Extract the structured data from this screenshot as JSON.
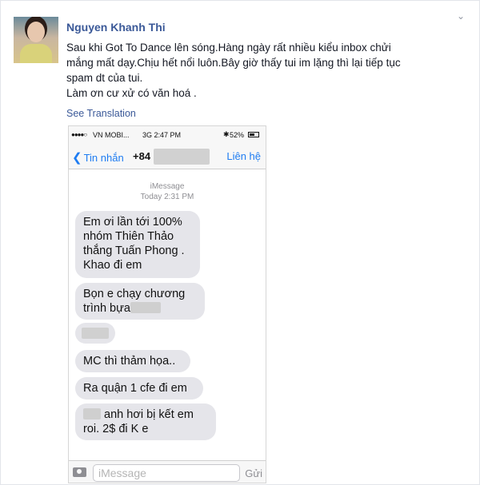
{
  "post": {
    "author": "Nguyen Khanh Thi",
    "lines": [
      "Sau khi Got To Dance lên sóng.Hàng ngày rất nhiều kiểu inbox chửi",
      "mắng mất dạy.Chịu hết nổi luôn.Bây giờ thấy tui im lặng thì lại tiếp tục",
      "spam dt của tui.",
      "Làm ơn cư xử có văn hoá ."
    ],
    "see_translation": "See Translation",
    "menu_icon": "chevron-down-icon"
  },
  "phone": {
    "status": {
      "signal": "●●●●○",
      "carrier": "VN MOBI...",
      "network_time": "3G 2:47 PM",
      "bluetooth": "✱",
      "battery": "52%"
    },
    "nav": {
      "back_label": "Tin nhắn",
      "number": "+84",
      "contact_label": "Liên hệ"
    },
    "thread": {
      "label": "iMessage",
      "date": "Today 2:31 PM"
    },
    "messages": {
      "m1": [
        "Em ơi lần tới 100%",
        "nhóm Thiên Thảo",
        "thắng Tuấn Phong .",
        "Khao đi em"
      ],
      "m2_line1": "Bọn e chạy chương",
      "m2_line2": "trình bựa",
      "m4": "MC thì thảm họa..",
      "m5": "Ra quận 1 cfe đi em",
      "m6_line1": "anh hơi bị kết em",
      "m6_line2": "roi. 2$ đi K e"
    },
    "input": {
      "placeholder": "iMessage",
      "send_label": "Gửi"
    }
  }
}
